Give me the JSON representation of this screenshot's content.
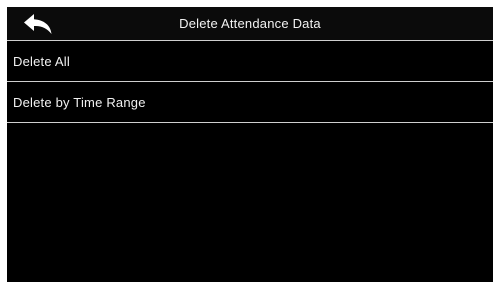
{
  "header": {
    "title": "Delete Attendance Data",
    "back_icon": "back-arrow-icon"
  },
  "menu": {
    "items": [
      {
        "label": "Delete All"
      },
      {
        "label": "Delete by Time Range"
      }
    ]
  },
  "colors": {
    "background": "#000000",
    "text": "#ffffff",
    "divider": "#cfcfcf"
  }
}
